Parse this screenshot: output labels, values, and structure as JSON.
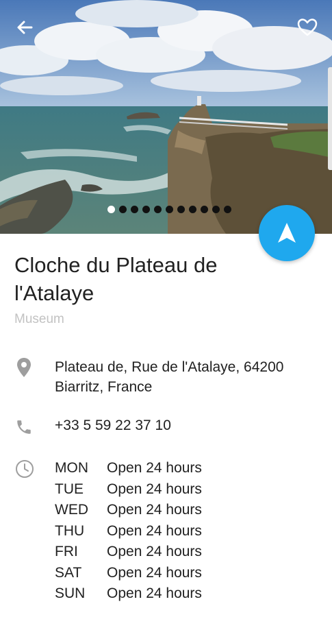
{
  "place": {
    "name": "Cloche du Plateau de l'Atalaye",
    "category": "Museum",
    "address": "Plateau de, Rue de l'Atalaye, 64200 Biarritz, France",
    "phone": "+33 5 59 22 37 10"
  },
  "gallery": {
    "photo_count": 11,
    "active_index": 0
  },
  "hours": [
    {
      "day": "MON",
      "status": "Open 24 hours"
    },
    {
      "day": "TUE",
      "status": "Open 24 hours"
    },
    {
      "day": "WED",
      "status": "Open 24 hours"
    },
    {
      "day": "THU",
      "status": "Open 24 hours"
    },
    {
      "day": "FRI",
      "status": "Open 24 hours"
    },
    {
      "day": "SAT",
      "status": "Open 24 hours"
    },
    {
      "day": "SUN",
      "status": "Open 24 hours"
    }
  ],
  "icons": {
    "back": "back-arrow-icon",
    "favorite": "heart-outline-icon",
    "navigate": "navigation-arrow-icon",
    "location": "location-pin-icon",
    "phone": "phone-icon",
    "hours": "clock-icon"
  },
  "colors": {
    "accent": "#1fa8ee",
    "text": "#212121",
    "secondary_text": "#c2c2c2",
    "icon": "#9e9e9e"
  }
}
